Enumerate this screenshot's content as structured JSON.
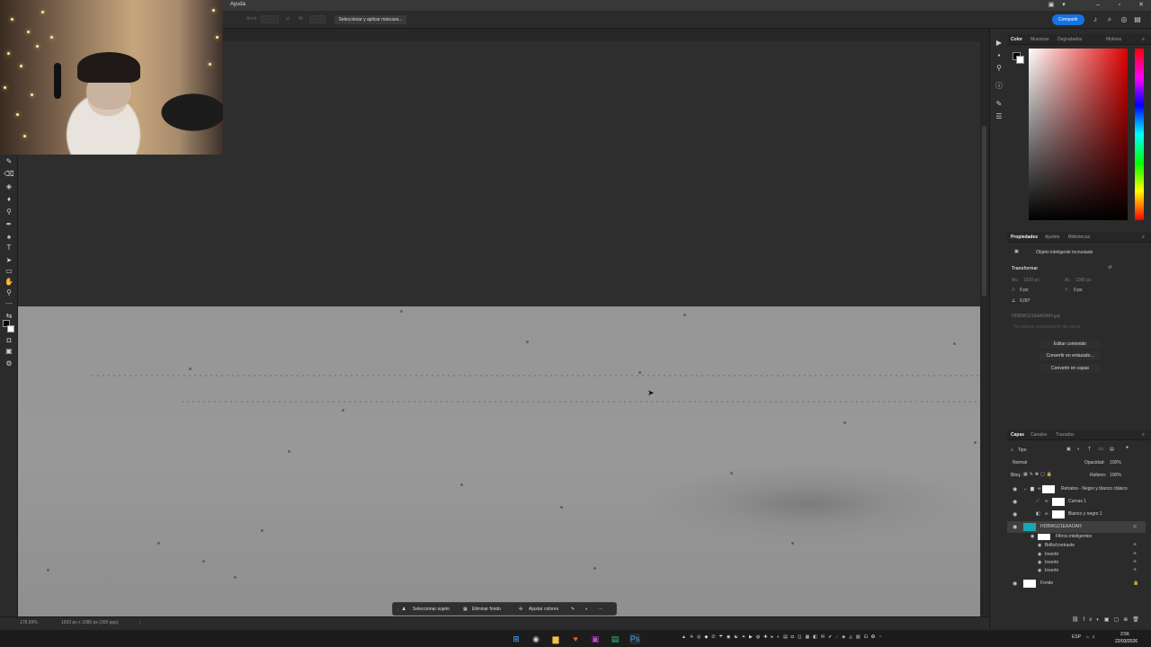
{
  "menubar": {
    "menu": "Ayuda"
  },
  "optbar": {
    "field_label_1": "Anch:",
    "field_label_2": "Al:",
    "mask_button": "Seleccionar y aplicar máscara...",
    "share_button": "Compartir"
  },
  "context_bar": {
    "select_subject": "Seleccionar sujeto",
    "remove_background": "Eliminar fondo",
    "adjust_colors": "Ajustar colores"
  },
  "status": {
    "zoom": "178,69%",
    "dimensions": "1920 px x 1080 px (300 ppp)"
  },
  "color_panel": {
    "tabs": [
      "Color",
      "Muestras",
      "Degradados",
      "Motivos"
    ],
    "active": 0,
    "foreground": "#000000",
    "background": "#ffffff"
  },
  "properties_panel": {
    "tabs": [
      "Propiedades",
      "Ajustes",
      "Bibliotecas"
    ],
    "active": 0,
    "object_type": "Objeto inteligente incrustado",
    "transform_title": "Transformar",
    "width_label": "An.:",
    "width_value": "1920 px",
    "height_label": "Al.:",
    "height_value": "1080 px",
    "x_label": "X:",
    "x_value": "0 px",
    "y_label": "Y:",
    "y_value": "0 px",
    "angle_value": "0,00°",
    "filename": "HDBWG21EAAOAH.jpg",
    "comp_placeholder": "No aplicar composición de capas",
    "btn_edit": "Editar contenido",
    "btn_convert_linked": "Convertir en enlazado...",
    "btn_convert_layers": "Convertir en capas"
  },
  "layers_panel": {
    "tabs": [
      "Capas",
      "Canales",
      "Trazados"
    ],
    "active": 0,
    "filter_label": "Tipo",
    "blend_mode": "Normal",
    "opacity_label": "Opacidad:",
    "opacity_value": "100%",
    "lock_label": "Bloq.:",
    "fill_label": "Relleno:",
    "fill_value": "100%",
    "layers": [
      {
        "name": "Retratos - Negro y blanco clásico",
        "kind": "group"
      },
      {
        "name": "Curvas 1",
        "kind": "adjustment"
      },
      {
        "name": "Blanco y negro 1",
        "kind": "adjustment"
      },
      {
        "name": "HDBWG21EAAOAH",
        "kind": "smart",
        "selected": true
      },
      {
        "name": "Fondo",
        "kind": "background"
      }
    ],
    "smart_filters_label": "Filtros inteligentes",
    "smart_filters": [
      "Brillo/contraste",
      "Invertir",
      "Invertir",
      "Invertir"
    ]
  },
  "taskbar": {
    "language": "ESP",
    "time": "2:56",
    "date": "22/03/2026"
  }
}
